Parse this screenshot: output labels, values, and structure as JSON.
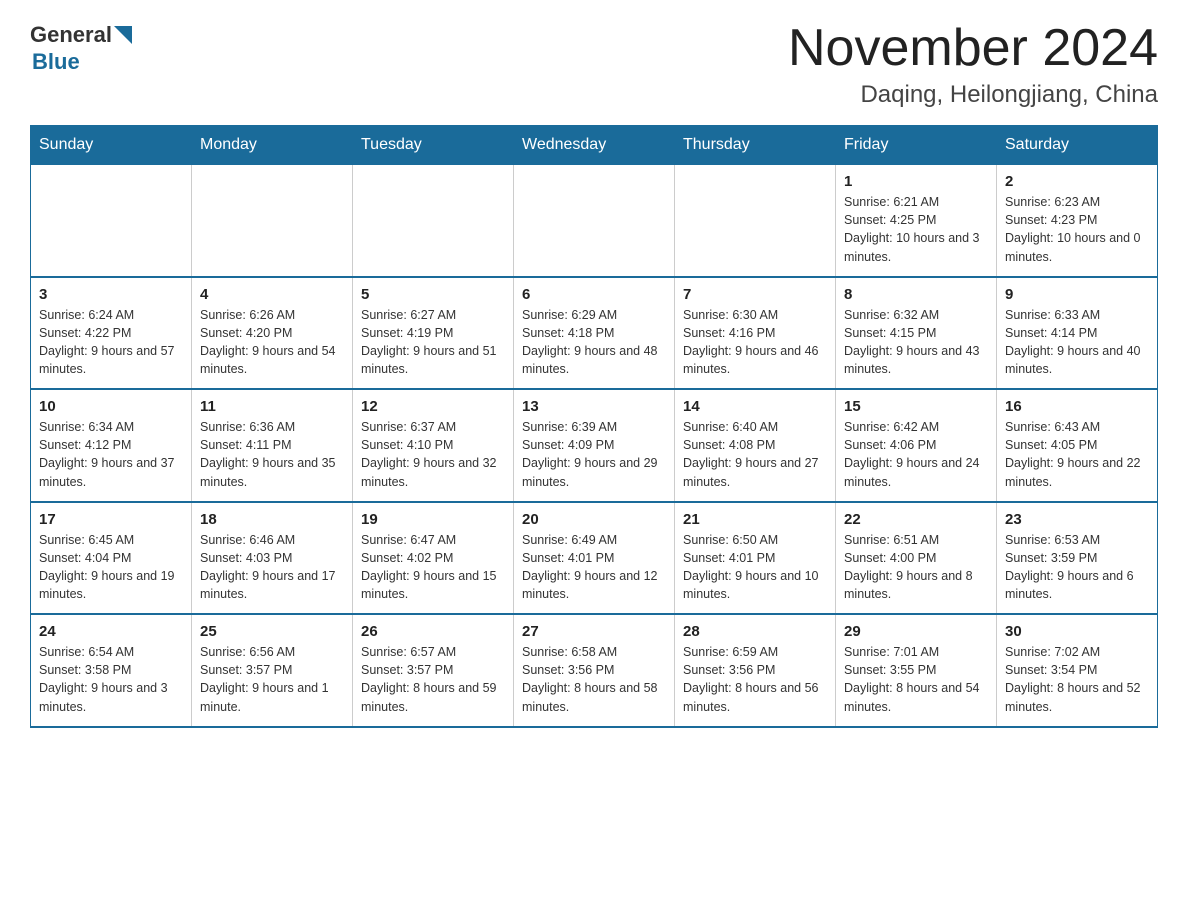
{
  "header": {
    "logo_general": "General",
    "logo_blue": "Blue",
    "month_title": "November 2024",
    "location": "Daqing, Heilongjiang, China"
  },
  "weekdays": [
    "Sunday",
    "Monday",
    "Tuesday",
    "Wednesday",
    "Thursday",
    "Friday",
    "Saturday"
  ],
  "weeks": [
    [
      {
        "day": "",
        "info": ""
      },
      {
        "day": "",
        "info": ""
      },
      {
        "day": "",
        "info": ""
      },
      {
        "day": "",
        "info": ""
      },
      {
        "day": "",
        "info": ""
      },
      {
        "day": "1",
        "info": "Sunrise: 6:21 AM\nSunset: 4:25 PM\nDaylight: 10 hours and 3 minutes."
      },
      {
        "day": "2",
        "info": "Sunrise: 6:23 AM\nSunset: 4:23 PM\nDaylight: 10 hours and 0 minutes."
      }
    ],
    [
      {
        "day": "3",
        "info": "Sunrise: 6:24 AM\nSunset: 4:22 PM\nDaylight: 9 hours and 57 minutes."
      },
      {
        "day": "4",
        "info": "Sunrise: 6:26 AM\nSunset: 4:20 PM\nDaylight: 9 hours and 54 minutes."
      },
      {
        "day": "5",
        "info": "Sunrise: 6:27 AM\nSunset: 4:19 PM\nDaylight: 9 hours and 51 minutes."
      },
      {
        "day": "6",
        "info": "Sunrise: 6:29 AM\nSunset: 4:18 PM\nDaylight: 9 hours and 48 minutes."
      },
      {
        "day": "7",
        "info": "Sunrise: 6:30 AM\nSunset: 4:16 PM\nDaylight: 9 hours and 46 minutes."
      },
      {
        "day": "8",
        "info": "Sunrise: 6:32 AM\nSunset: 4:15 PM\nDaylight: 9 hours and 43 minutes."
      },
      {
        "day": "9",
        "info": "Sunrise: 6:33 AM\nSunset: 4:14 PM\nDaylight: 9 hours and 40 minutes."
      }
    ],
    [
      {
        "day": "10",
        "info": "Sunrise: 6:34 AM\nSunset: 4:12 PM\nDaylight: 9 hours and 37 minutes."
      },
      {
        "day": "11",
        "info": "Sunrise: 6:36 AM\nSunset: 4:11 PM\nDaylight: 9 hours and 35 minutes."
      },
      {
        "day": "12",
        "info": "Sunrise: 6:37 AM\nSunset: 4:10 PM\nDaylight: 9 hours and 32 minutes."
      },
      {
        "day": "13",
        "info": "Sunrise: 6:39 AM\nSunset: 4:09 PM\nDaylight: 9 hours and 29 minutes."
      },
      {
        "day": "14",
        "info": "Sunrise: 6:40 AM\nSunset: 4:08 PM\nDaylight: 9 hours and 27 minutes."
      },
      {
        "day": "15",
        "info": "Sunrise: 6:42 AM\nSunset: 4:06 PM\nDaylight: 9 hours and 24 minutes."
      },
      {
        "day": "16",
        "info": "Sunrise: 6:43 AM\nSunset: 4:05 PM\nDaylight: 9 hours and 22 minutes."
      }
    ],
    [
      {
        "day": "17",
        "info": "Sunrise: 6:45 AM\nSunset: 4:04 PM\nDaylight: 9 hours and 19 minutes."
      },
      {
        "day": "18",
        "info": "Sunrise: 6:46 AM\nSunset: 4:03 PM\nDaylight: 9 hours and 17 minutes."
      },
      {
        "day": "19",
        "info": "Sunrise: 6:47 AM\nSunset: 4:02 PM\nDaylight: 9 hours and 15 minutes."
      },
      {
        "day": "20",
        "info": "Sunrise: 6:49 AM\nSunset: 4:01 PM\nDaylight: 9 hours and 12 minutes."
      },
      {
        "day": "21",
        "info": "Sunrise: 6:50 AM\nSunset: 4:01 PM\nDaylight: 9 hours and 10 minutes."
      },
      {
        "day": "22",
        "info": "Sunrise: 6:51 AM\nSunset: 4:00 PM\nDaylight: 9 hours and 8 minutes."
      },
      {
        "day": "23",
        "info": "Sunrise: 6:53 AM\nSunset: 3:59 PM\nDaylight: 9 hours and 6 minutes."
      }
    ],
    [
      {
        "day": "24",
        "info": "Sunrise: 6:54 AM\nSunset: 3:58 PM\nDaylight: 9 hours and 3 minutes."
      },
      {
        "day": "25",
        "info": "Sunrise: 6:56 AM\nSunset: 3:57 PM\nDaylight: 9 hours and 1 minute."
      },
      {
        "day": "26",
        "info": "Sunrise: 6:57 AM\nSunset: 3:57 PM\nDaylight: 8 hours and 59 minutes."
      },
      {
        "day": "27",
        "info": "Sunrise: 6:58 AM\nSunset: 3:56 PM\nDaylight: 8 hours and 58 minutes."
      },
      {
        "day": "28",
        "info": "Sunrise: 6:59 AM\nSunset: 3:56 PM\nDaylight: 8 hours and 56 minutes."
      },
      {
        "day": "29",
        "info": "Sunrise: 7:01 AM\nSunset: 3:55 PM\nDaylight: 8 hours and 54 minutes."
      },
      {
        "day": "30",
        "info": "Sunrise: 7:02 AM\nSunset: 3:54 PM\nDaylight: 8 hours and 52 minutes."
      }
    ]
  ]
}
